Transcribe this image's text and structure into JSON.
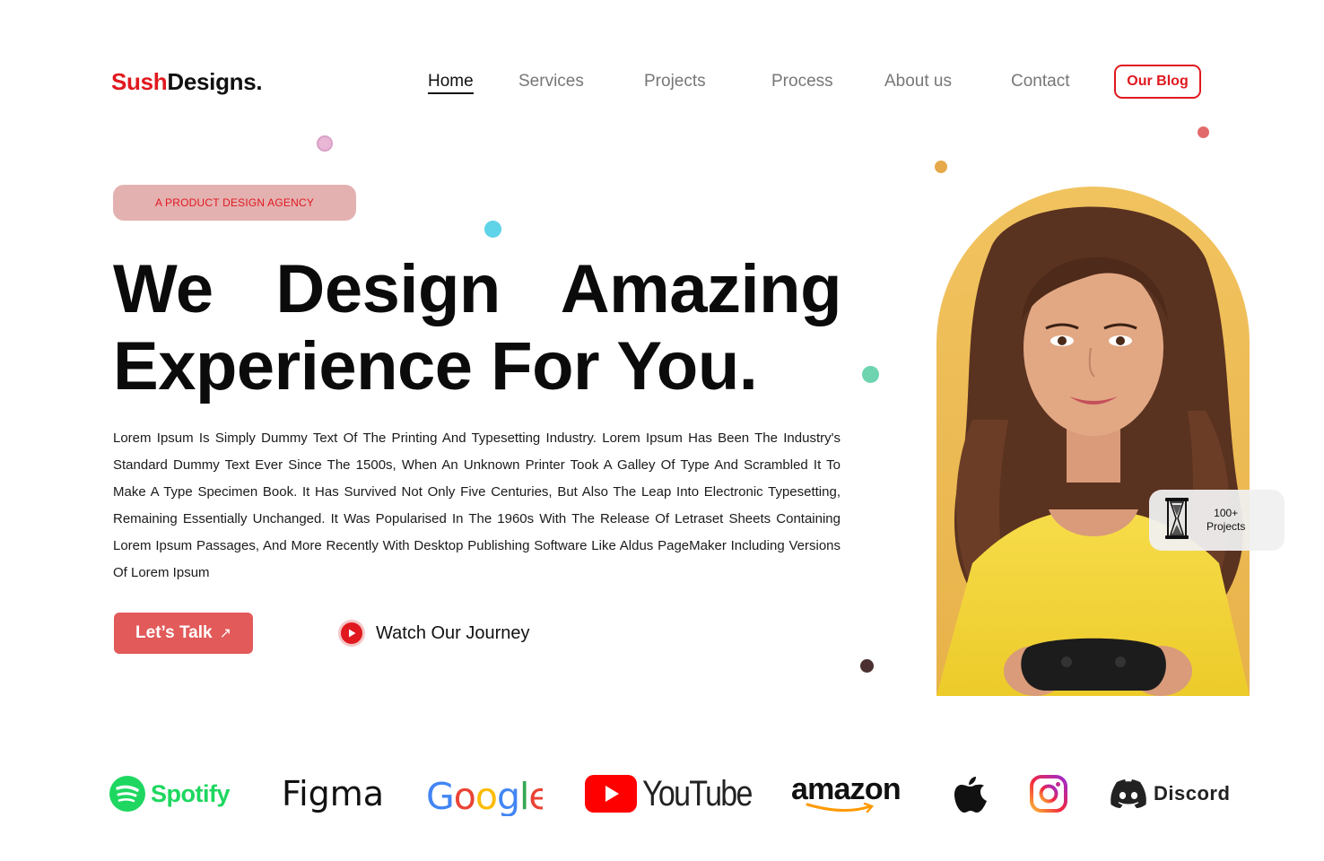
{
  "brand": {
    "accent_part": "Sush",
    "rest_part": "Designs.",
    "accent_color": "#e0191f"
  },
  "nav": {
    "items": [
      {
        "label": "Home",
        "active": true
      },
      {
        "label": "Services",
        "active": false
      },
      {
        "label": "Projects",
        "active": false
      },
      {
        "label": "Process",
        "active": false
      },
      {
        "label": "About us",
        "active": false
      },
      {
        "label": "Contact",
        "active": false
      }
    ],
    "blog_button": "Our Blog"
  },
  "hero": {
    "tag": "A PRODUCT DESIGN AGENCY",
    "headline_line1": "We Design Amazing",
    "headline_line2": "Experience For You.",
    "description": "Lorem Ipsum Is Simply Dummy Text Of The Printing And Typesetting Industry. Lorem Ipsum Has Been The Industry's Standard Dummy Text Ever Since The 1500s, When An Unknown Printer Took A Galley Of Type And Scrambled It To Make A Type Specimen Book. It Has Survived Not Only Five Centuries, But Also The Leap Into Electronic Typesetting, Remaining Essentially Unchanged. It Was Popularised In The 1960s With The Release Of Letraset Sheets Containing Lorem Ipsum Passages, And More Recently With Desktop Publishing Software Like Aldus PageMaker Including Versions Of Lorem Ipsum",
    "cta_label": "Let’s Talk",
    "cta_icon": "arrow-up-right-icon",
    "watch_label": "Watch Our Journey",
    "watch_icon": "play-icon"
  },
  "projects_badge": {
    "count": "100+",
    "label": "Projects",
    "icon": "hourglass-icon"
  },
  "partners": [
    {
      "name": "Spotify",
      "icon": "spotify-logo"
    },
    {
      "name": "Figma",
      "icon": "figma-logo"
    },
    {
      "name": "Google",
      "icon": "google-logo"
    },
    {
      "name": "YouTube",
      "icon": "youtube-logo"
    },
    {
      "name": "amazon",
      "icon": "amazon-logo"
    },
    {
      "name": "",
      "icon": "apple-logo"
    },
    {
      "name": "",
      "icon": "instagram-logo"
    },
    {
      "name": "Discord",
      "icon": "discord-logo"
    }
  ],
  "colors": {
    "primary": "#e0191f",
    "cta": "#e25a5a",
    "tag_bg": "#e4b1b1",
    "photo_bg": "#f0bf58"
  }
}
